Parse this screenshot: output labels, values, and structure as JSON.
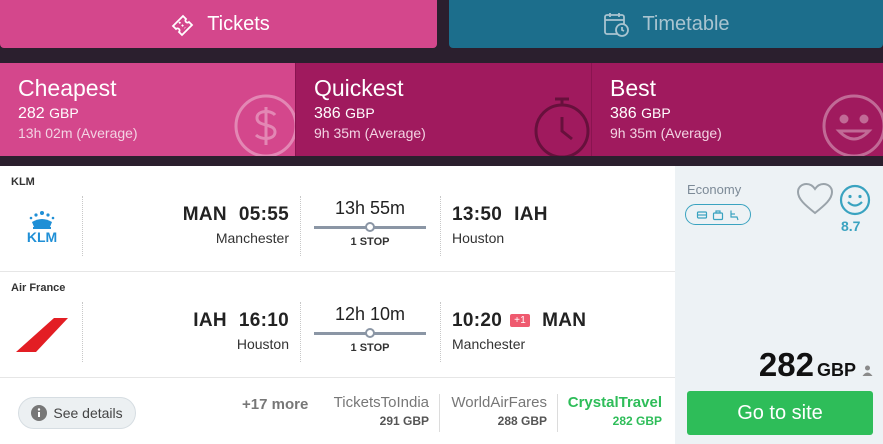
{
  "modes": {
    "tickets": "Tickets",
    "timetable": "Timetable"
  },
  "sort_tabs": [
    {
      "title": "Cheapest",
      "price": "282",
      "currency": "GBP",
      "avg": "13h 02m (Average)"
    },
    {
      "title": "Quickest",
      "price": "386",
      "currency": "GBP",
      "avg": "9h 35m (Average)"
    },
    {
      "title": "Best",
      "price": "386",
      "currency": "GBP",
      "avg": "9h 35m (Average)"
    }
  ],
  "legs": [
    {
      "airline": "KLM",
      "logo_text": "KLM",
      "dep_code": "MAN",
      "dep_time": "05:55",
      "dep_city": "Manchester",
      "duration": "13h 55m",
      "stops": "1 STOP",
      "arr_time": "13:50",
      "arr_code": "IAH",
      "arr_city": "Houston",
      "plus_day": ""
    },
    {
      "airline": "Air France",
      "dep_code": "IAH",
      "dep_time": "16:10",
      "dep_city": "Houston",
      "duration": "12h 10m",
      "stops": "1 STOP",
      "arr_time": "10:20",
      "arr_code": "MAN",
      "arr_city": "Manchester",
      "plus_day": "+1"
    }
  ],
  "right_panel": {
    "cabin": "Economy",
    "score": "8.7",
    "price": "282",
    "currency": "GBP",
    "cta": "Go to site"
  },
  "bottom": {
    "see_details": "See details",
    "more": "+17 more",
    "providers": [
      {
        "name": "TicketsToIndia",
        "price": "291 GBP"
      },
      {
        "name": "WorldAirFares",
        "price": "288 GBP"
      },
      {
        "name": "CrystalTravel",
        "price": "282 GBP"
      }
    ]
  },
  "colors": {
    "pink": "#d4478c",
    "magenta_dark": "#a01a5e",
    "teal": "#1c6e8c",
    "green": "#2ebd59",
    "accent_blue": "#3aa3c0"
  },
  "icons": {
    "tickets": "ticket-icon",
    "timetable": "calendar-clock-icon",
    "cheapest": "dollar-coin-icon",
    "quickest": "stopwatch-icon",
    "best": "smiley-icon"
  }
}
